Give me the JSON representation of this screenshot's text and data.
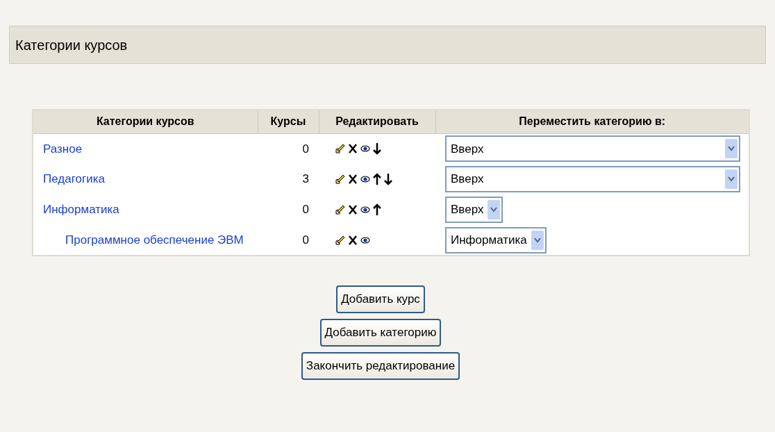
{
  "heading": "Категории курсов",
  "table": {
    "columns": [
      "Категории курсов",
      "Курсы",
      "Редактировать",
      "Переместить категорию в:"
    ],
    "rows": [
      {
        "name": "Разное",
        "courses": "0",
        "actions": [
          {
            "kind": "edit"
          },
          {
            "kind": "delete"
          },
          {
            "kind": "hide"
          },
          {
            "kind": "down"
          }
        ],
        "move_to": {
          "value": "Вверх",
          "kind": "wide"
        }
      },
      {
        "name": "Педагогика",
        "courses": "3",
        "actions": [
          {
            "kind": "edit"
          },
          {
            "kind": "delete"
          },
          {
            "kind": "hide"
          },
          {
            "kind": "up"
          },
          {
            "kind": "down"
          }
        ],
        "move_to": {
          "value": "Вверх",
          "kind": "wide"
        }
      },
      {
        "name": "Информатика",
        "courses": "0",
        "actions": [
          {
            "kind": "edit"
          },
          {
            "kind": "delete"
          },
          {
            "kind": "hide"
          },
          {
            "kind": "up"
          }
        ],
        "move_to": {
          "value": "Вверх",
          "kind": "narrow"
        },
        "children": [
          {
            "name": "Программное обеспечение ЭВМ",
            "courses": "0",
            "actions": [
              {
                "kind": "edit"
              },
              {
                "kind": "delete"
              },
              {
                "kind": "hide"
              }
            ],
            "move_to": {
              "value": "Информатика",
              "kind": "narrow"
            }
          }
        ]
      }
    ]
  },
  "buttons": [
    "Добавить курс",
    "Добавить категорию",
    "Закончить редактирование"
  ]
}
